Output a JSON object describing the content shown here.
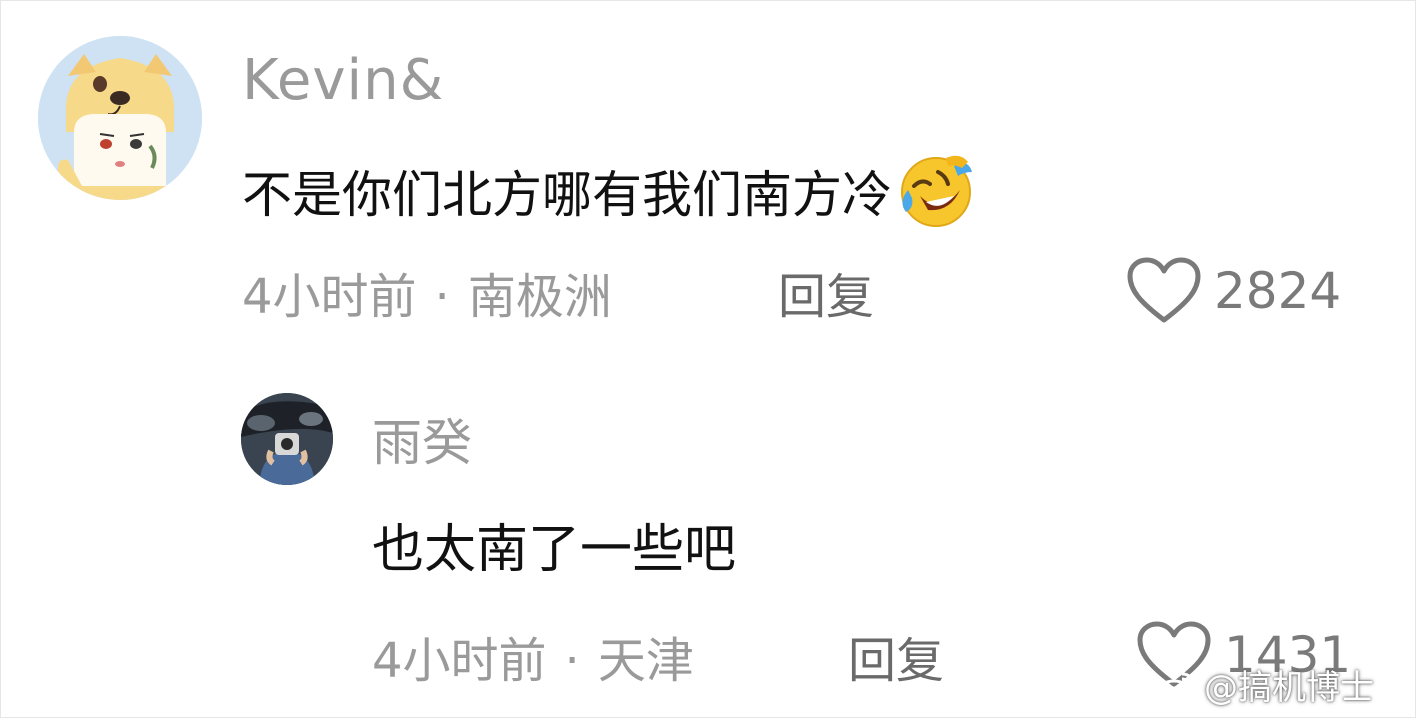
{
  "comments": [
    {
      "username": "Kevin&",
      "text": "不是你们北方哪有我们南方冷",
      "emoji": "rolling-on-floor-laughing-emoji",
      "time": "4小时前",
      "separator": "·",
      "location": "南极洲",
      "reply_label": "回复",
      "like_count": "2824"
    },
    {
      "username": "雨癸",
      "text": "也太南了一些吧",
      "time": "4小时前",
      "separator": "·",
      "location": "天津",
      "reply_label": "回复",
      "like_count": "1431"
    }
  ],
  "watermark": {
    "text": "@搞机博士",
    "icon": "weibo-icon"
  },
  "colors": {
    "text_primary": "#111111",
    "text_secondary": "#9a9a9a",
    "reply": "#6a6a6a",
    "emoji_yellow": "#f7c62c"
  }
}
